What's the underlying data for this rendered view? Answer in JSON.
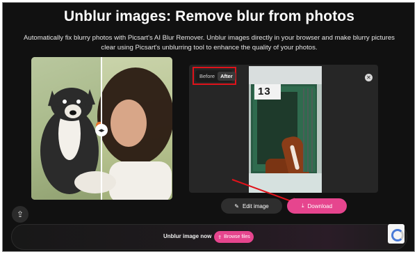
{
  "header": {
    "title": "Unblur images: Remove blur from photos",
    "subtitle": "Automatically fix blurry photos with Picsart's AI Blur Remover. Unblur images directly in your browser and make blurry pictures clear using Picsart's unblurring tool to enhance the quality of your photos."
  },
  "demo": {
    "handle_icon": "arrows-left-right-icon"
  },
  "editor": {
    "toggle": {
      "before_label": "Before",
      "after_label": "After",
      "selected": "After"
    },
    "close_icon": "close-icon",
    "photo": {
      "stall_number": "13"
    }
  },
  "actions": {
    "edit_label": "Edit image",
    "download_label": "Download"
  },
  "bottom": {
    "cta_text": "Unblur image now",
    "browse_label": "Browse files"
  },
  "colors": {
    "accent": "#e6458e",
    "highlight_box": "#e0121a",
    "background": "#111111"
  }
}
